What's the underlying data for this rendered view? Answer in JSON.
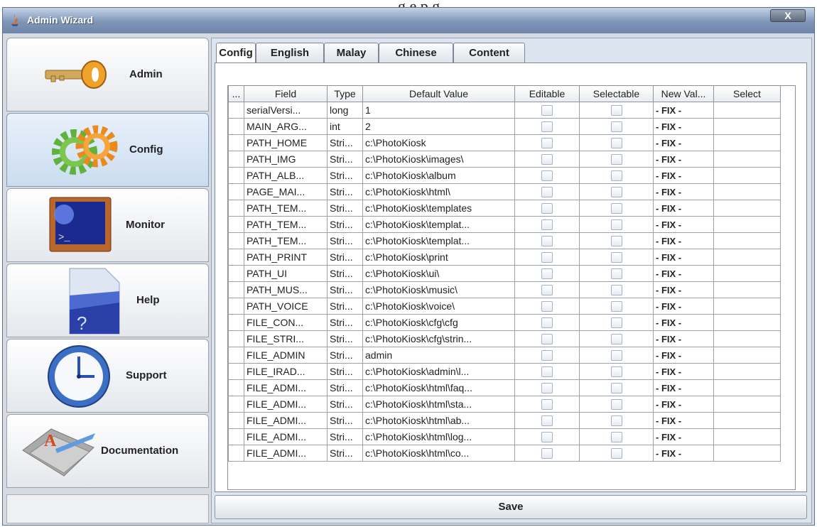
{
  "background_caption": "g e                                    p                   g",
  "window": {
    "title": "Admin Wizard",
    "close_label": "X"
  },
  "sidebar": {
    "items": [
      {
        "label": "Admin",
        "icon": "key-icon"
      },
      {
        "label": "Config",
        "icon": "gears-icon"
      },
      {
        "label": "Monitor",
        "icon": "monitor-icon"
      },
      {
        "label": "Help",
        "icon": "help-icon"
      },
      {
        "label": "Support",
        "icon": "clock-icon"
      },
      {
        "label": "Documentation",
        "icon": "documentation-icon"
      }
    ],
    "active": "Config"
  },
  "tabs": [
    {
      "label": "Config",
      "active": true
    },
    {
      "label": "English",
      "active": false
    },
    {
      "label": "Malay",
      "active": false
    },
    {
      "label": "Chinese",
      "active": false
    },
    {
      "label": "Content",
      "active": false
    }
  ],
  "table": {
    "headers": [
      "...",
      "Field",
      "Type",
      "Default Value",
      "Editable",
      "Selectable",
      "New Val...",
      "Select"
    ],
    "rows": [
      {
        "field": "serialVersi...",
        "type": "long",
        "default": "1",
        "newval": "- FIX -"
      },
      {
        "field": "MAIN_ARG...",
        "type": "int",
        "default": "2",
        "newval": "- FIX -"
      },
      {
        "field": "PATH_HOME",
        "type": "Stri...",
        "default": "c:\\PhotoKiosk",
        "newval": "- FIX -"
      },
      {
        "field": "PATH_IMG",
        "type": "Stri...",
        "default": "c:\\PhotoKiosk\\images\\",
        "newval": "- FIX -"
      },
      {
        "field": "PATH_ALB...",
        "type": "Stri...",
        "default": "c:\\PhotoKiosk\\album",
        "newval": "- FIX -"
      },
      {
        "field": "PAGE_MAI...",
        "type": "Stri...",
        "default": "c:\\PhotoKiosk\\html\\",
        "newval": "- FIX -"
      },
      {
        "field": "PATH_TEM...",
        "type": "Stri...",
        "default": "c:\\PhotoKiosk\\templates",
        "newval": "- FIX -"
      },
      {
        "field": "PATH_TEM...",
        "type": "Stri...",
        "default": "c:\\PhotoKiosk\\templat...",
        "newval": "- FIX -"
      },
      {
        "field": "PATH_TEM...",
        "type": "Stri...",
        "default": "c:\\PhotoKiosk\\templat...",
        "newval": "- FIX -"
      },
      {
        "field": "PATH_PRINT",
        "type": "Stri...",
        "default": "c:\\PhotoKiosk\\print",
        "newval": "- FIX -"
      },
      {
        "field": "PATH_UI",
        "type": "Stri...",
        "default": "c:\\PhotoKiosk\\ui\\",
        "newval": "- FIX -"
      },
      {
        "field": "PATH_MUS...",
        "type": "Stri...",
        "default": "c:\\PhotoKiosk\\music\\",
        "newval": "- FIX -"
      },
      {
        "field": "PATH_VOICE",
        "type": "Stri...",
        "default": "c:\\PhotoKiosk\\voice\\",
        "newval": "- FIX -"
      },
      {
        "field": "FILE_CON...",
        "type": "Stri...",
        "default": "c:\\PhotoKiosk\\cfg\\cfg",
        "newval": "- FIX -"
      },
      {
        "field": "FILE_STRI...",
        "type": "Stri...",
        "default": "c:\\PhotoKiosk\\cfg\\strin...",
        "newval": "- FIX -"
      },
      {
        "field": "FILE_ADMIN",
        "type": "Stri...",
        "default": "admin",
        "newval": "- FIX -"
      },
      {
        "field": "FILE_IRAD...",
        "type": "Stri...",
        "default": "c:\\PhotoKiosk\\admin\\l...",
        "newval": "- FIX -"
      },
      {
        "field": "FILE_ADMI...",
        "type": "Stri...",
        "default": "c:\\PhotoKiosk\\html\\faq...",
        "newval": "- FIX -"
      },
      {
        "field": "FILE_ADMI...",
        "type": "Stri...",
        "default": "c:\\PhotoKiosk\\html\\sta...",
        "newval": "- FIX -"
      },
      {
        "field": "FILE_ADMI...",
        "type": "Stri...",
        "default": "c:\\PhotoKiosk\\html\\ab...",
        "newval": "- FIX -"
      },
      {
        "field": "FILE_ADMI...",
        "type": "Stri...",
        "default": "c:\\PhotoKiosk\\html\\log...",
        "newval": "- FIX -"
      },
      {
        "field": "FILE_ADMI...",
        "type": "Stri...",
        "default": "c:\\PhotoKiosk\\html\\co...",
        "newval": "- FIX -"
      }
    ]
  },
  "save_label": "Save",
  "colors": {
    "titlebar": "#7e95b8",
    "active_sidebar": "#cbdcf0",
    "panel_bg": "#dce4ef"
  }
}
